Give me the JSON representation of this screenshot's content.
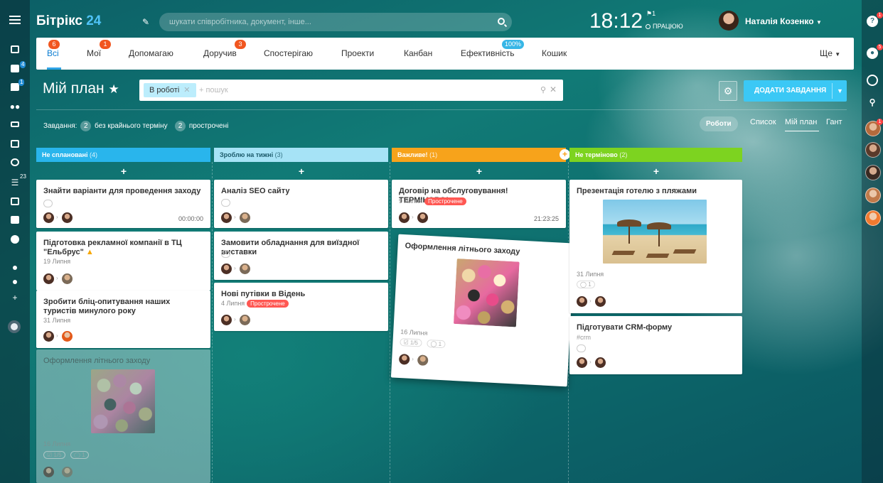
{
  "header": {
    "logo_main": "Бітрікс",
    "logo_num": "24",
    "search_placeholder": "шукати співробітника, документ, інше...",
    "clock": "18:12",
    "flag_count": "1",
    "status": "ПРАЦЮЮ",
    "user_name": "Наталія Козенко"
  },
  "left_sidebar": {
    "badges": {
      "tasks": "4",
      "chat": "1",
      "filters": "23"
    }
  },
  "right_sidebar": {
    "help_badge": "1",
    "notif_badge": "5",
    "avatar_badge": "1"
  },
  "tabs": [
    {
      "label": "Всі",
      "badge": "6"
    },
    {
      "label": "Мої",
      "badge": "1"
    },
    {
      "label": "Допомагаю"
    },
    {
      "label": "Доручив",
      "badge": "3"
    },
    {
      "label": "Спостерігаю"
    },
    {
      "label": "Проекти"
    },
    {
      "label": "Канбан"
    },
    {
      "label": "Ефективність",
      "badge": "100%"
    },
    {
      "label": "Кошик"
    },
    {
      "label": "Ще"
    }
  ],
  "plan": {
    "title": "Мій план",
    "filter_chip": "В роботі",
    "filter_placeholder": "+ пошук",
    "add_button": "ДОДАТИ ЗАВДАННЯ"
  },
  "counters": {
    "prefix": "Завдання:",
    "no_deadline_count": "2",
    "no_deadline_label": "без крайнього терміну",
    "overdue_count": "2",
    "overdue_label": "прострочені"
  },
  "views": {
    "roboti": "Роботи",
    "list": "Список",
    "myplan": "Мій план",
    "gantt": "Гант"
  },
  "colors": {
    "col1": "#29b5ec",
    "col2": "#a6e3f6",
    "col3": "#f7a31b",
    "col4": "#7dd320",
    "add_button": "#3bc8f5",
    "overdue": "#ff5752"
  },
  "columns": [
    {
      "title": "Не сплановані",
      "count": "(4)"
    },
    {
      "title": "Зроблю на тижні",
      "count": "(3)"
    },
    {
      "title": "Важливе!",
      "count": "(1)"
    },
    {
      "title": "Не терміново",
      "count": "(2)"
    }
  ],
  "cards": {
    "c1a": {
      "title": "Знайти варіанти для проведення заходу",
      "timer": "00:00:00"
    },
    "c1b": {
      "title": "Підготовка рекламної компанії в ТЦ \"Ельбрус\"",
      "date": "19 Липня"
    },
    "c1c": {
      "title": "Зробити бліц-опитування наших туристів минулого року",
      "date": "31 Липня"
    },
    "c1d": {
      "title": "Оформлення літнього заходу",
      "date": "16 Липня",
      "checklist": "1/5",
      "files": "1"
    },
    "c2a": {
      "title": "Аналіз SEO сайту"
    },
    "c2b": {
      "title": "Замовити обладнання для виїздної виставки"
    },
    "c2c": {
      "title": "Нові путівки в Відень",
      "date": "4 Липня",
      "overdue": "Прострочене"
    },
    "c3a": {
      "title": "Договір на обслуговування! ТЕРМІНОВО!",
      "date": "9 Липня",
      "overdue": "Прострочене",
      "timer": "21:23:25"
    },
    "c3b": {
      "title": "Оформлення літнього заходу",
      "date": "16 Липня",
      "checklist": "1/5",
      "files": "1"
    },
    "c4a": {
      "title": "Презентація готелю з пляжами",
      "date": "31 Липня",
      "files": "1"
    },
    "c4b": {
      "title": "Підготувати CRM-форму",
      "tag": "#crm"
    }
  }
}
